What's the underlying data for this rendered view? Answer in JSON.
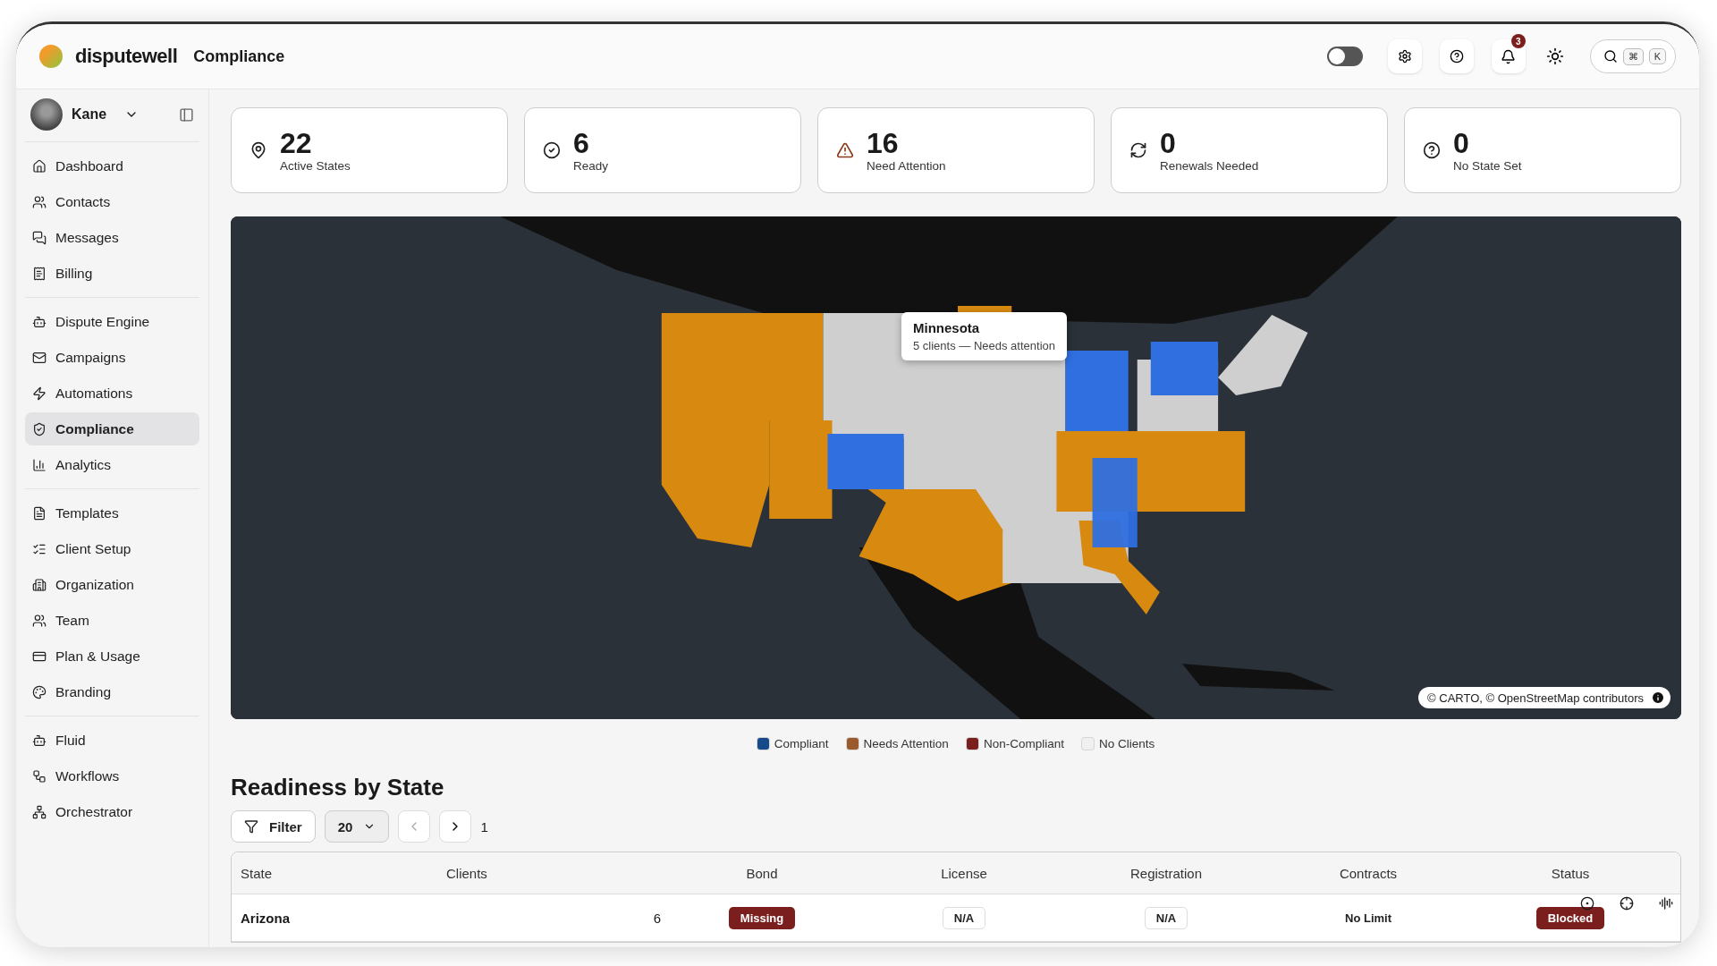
{
  "app": {
    "brand": "disputewell",
    "page_title": "Compliance"
  },
  "header": {
    "toggle": {
      "on": false
    },
    "notifications": {
      "count": "3"
    },
    "search_keys": [
      "⌘",
      "K"
    ]
  },
  "sidebar": {
    "user": {
      "name": "Kane"
    },
    "groups": [
      {
        "items": [
          {
            "label": "Dashboard",
            "selected": false
          },
          {
            "label": "Contacts",
            "selected": false
          },
          {
            "label": "Messages",
            "selected": false
          },
          {
            "label": "Billing",
            "selected": false
          }
        ]
      },
      {
        "items": [
          {
            "label": "Dispute Engine",
            "selected": false
          },
          {
            "label": "Campaigns",
            "selected": false
          },
          {
            "label": "Automations",
            "selected": false
          },
          {
            "label": "Compliance",
            "selected": true
          },
          {
            "label": "Analytics",
            "selected": false
          }
        ]
      },
      {
        "items": [
          {
            "label": "Templates",
            "selected": false
          },
          {
            "label": "Client Setup",
            "selected": false
          },
          {
            "label": "Organization",
            "selected": false
          },
          {
            "label": "Team",
            "selected": false
          },
          {
            "label": "Plan & Usage",
            "selected": false
          },
          {
            "label": "Branding",
            "selected": false
          }
        ]
      },
      {
        "items": [
          {
            "label": "Fluid",
            "selected": false
          },
          {
            "label": "Workflows",
            "selected": false
          },
          {
            "label": "Orchestrator",
            "selected": false
          }
        ]
      }
    ]
  },
  "stats": [
    {
      "value": "22",
      "label": "Active States",
      "kind": "pin"
    },
    {
      "value": "6",
      "label": "Ready",
      "kind": "check"
    },
    {
      "value": "16",
      "label": "Need Attention",
      "kind": "warning"
    },
    {
      "value": "0",
      "label": "Renewals Needed",
      "kind": "refresh"
    },
    {
      "value": "0",
      "label": "No State Set",
      "kind": "help"
    }
  ],
  "map": {
    "kind": "picture",
    "tooltip": {
      "title": "Minnesota",
      "detail": "5 clients — Needs attention"
    },
    "attribution": "© CARTO, © OpenStreetMap contributors"
  },
  "legend": [
    {
      "label": "Compliant",
      "color": "#174a8b"
    },
    {
      "label": "Needs Attention",
      "color": "#9b5a2c"
    },
    {
      "label": "Non-Compliant",
      "color": "#7b1e1e"
    },
    {
      "label": "No Clients",
      "color": "#f0f0f0"
    }
  ],
  "section_title": "Readiness by State",
  "toolbar": {
    "filter": "Filter",
    "page_size": "20",
    "page": "1"
  },
  "table": {
    "columns": [
      "State",
      "Clients",
      "Bond",
      "License",
      "Registration",
      "Contracts",
      "Status"
    ],
    "rows": [
      {
        "cells": [
          {
            "text": "Arizona",
            "kind": "name"
          },
          {
            "text": "6",
            "kind": "number"
          },
          {
            "text": "Missing",
            "kind": "alert"
          },
          {
            "text": "N/A",
            "kind": "outline"
          },
          {
            "text": "N/A",
            "kind": "outline"
          },
          {
            "text": "No Limit",
            "kind": "plain"
          },
          {
            "text": "Blocked",
            "kind": "alert"
          }
        ]
      }
    ]
  }
}
